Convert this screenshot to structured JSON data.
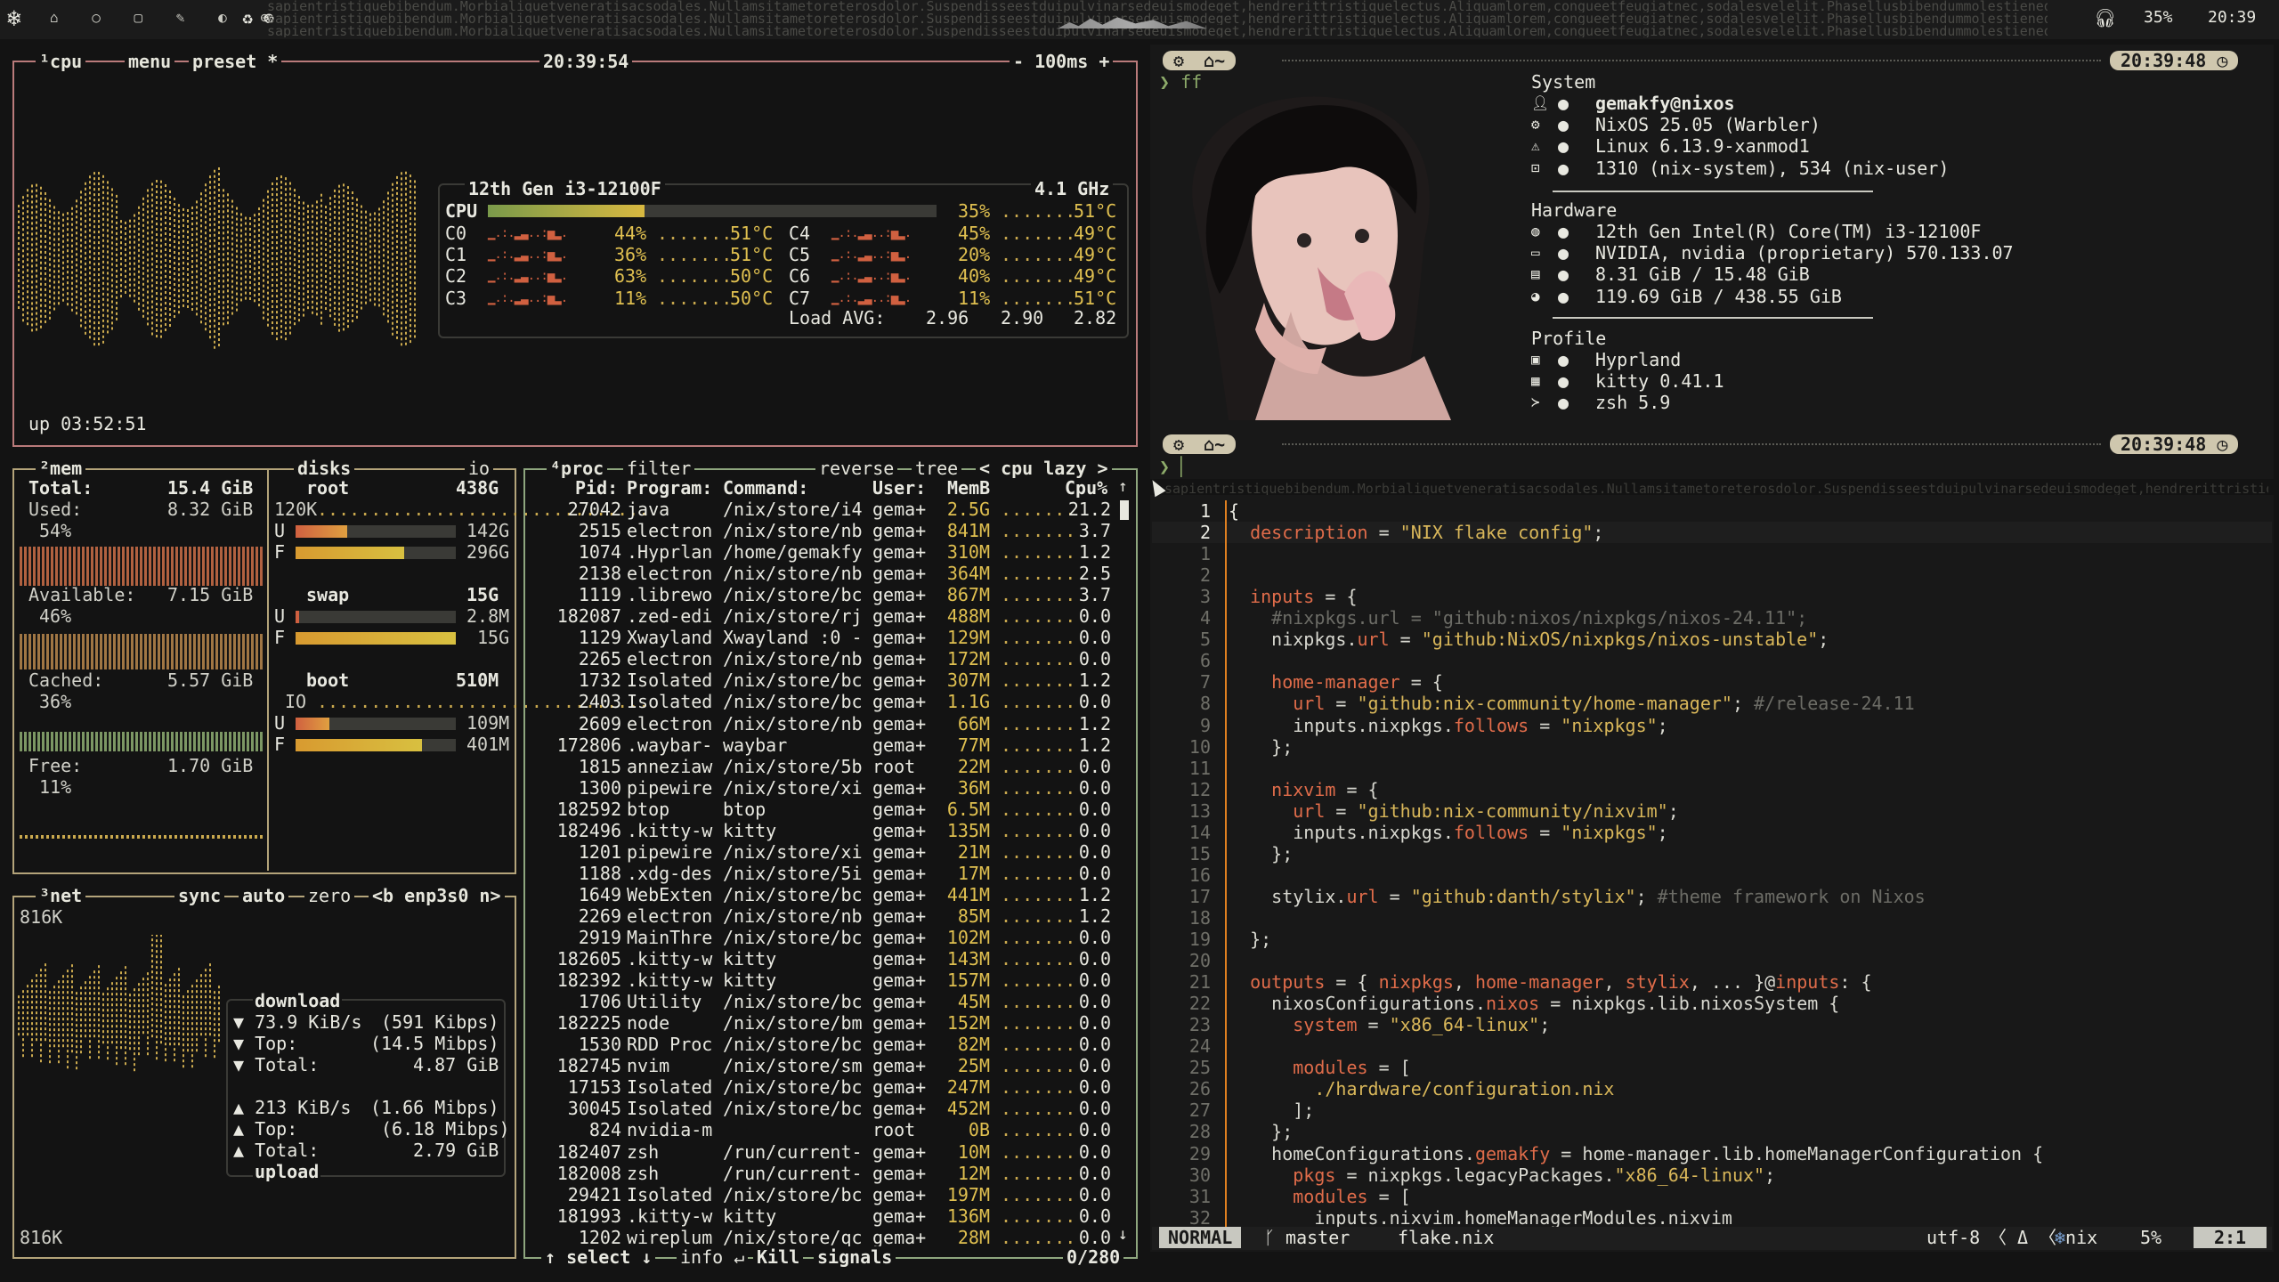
{
  "topbar": {
    "percent": "35%",
    "clock": "20:39",
    "noise": "sapientristiquebibendum.Morbialiquetveneratisacsodales.Nullamsitametoreterosdolor.Suspendisseestduipulvinarsedeuismodeget,hendrerittristiquelectus.Aliquamlorem,congueetfeugiatnec,sodalesvelelit.Phasellusbibendummolestieneque,velsuscipitmolestieque.Inhacha"
  },
  "cpu": {
    "title": "cpu",
    "menu": "menu",
    "preset": "preset *",
    "time": "20:39:54",
    "rate": "- 100ms +",
    "uptime": "up 03:52:51",
    "model": "12th Gen i3-12100F",
    "freq": "4.1 GHz",
    "total_label": "CPU",
    "total_pct": "35%",
    "total_temp": "51°C",
    "total_fill": 0.35,
    "cores": [
      {
        "name": "C0",
        "pct": "44%",
        "temp": "51°C"
      },
      {
        "name": "C1",
        "pct": "36%",
        "temp": "51°C"
      },
      {
        "name": "C2",
        "pct": "63%",
        "temp": "50°C"
      },
      {
        "name": "C3",
        "pct": "11%",
        "temp": "50°C"
      },
      {
        "name": "C4",
        "pct": "45%",
        "temp": "49°C"
      },
      {
        "name": "C5",
        "pct": "20%",
        "temp": "49°C"
      },
      {
        "name": "C6",
        "pct": "40%",
        "temp": "49°C"
      },
      {
        "name": "C7",
        "pct": "11%",
        "temp": "51°C"
      }
    ],
    "load_label": "Load AVG:",
    "load": [
      "2.96",
      "2.90",
      "2.82"
    ]
  },
  "mem": {
    "title": "mem",
    "total_label": "Total:",
    "total": "15.4 GiB",
    "used_label": "Used:",
    "used": "8.32 GiB",
    "used_pct": "54%",
    "avail_label": "Available:",
    "avail": "7.15 GiB",
    "avail_pct": "46%",
    "cached_label": "Cached:",
    "cached": "5.57 GiB",
    "cached_pct": "36%",
    "free_label": "Free:",
    "free": "1.70 GiB",
    "free_pct": "11%"
  },
  "disks": {
    "title": "disks",
    "io": "io",
    "root": {
      "name": "root",
      "size": "438G",
      "io": "120K",
      "u": "142G",
      "f": "296G",
      "u_fill": 0.32,
      "f_fill": 0.68
    },
    "swap": {
      "name": "swap",
      "size": "15G",
      "u": "2.8M",
      "f": "15G",
      "u_fill": 0.02,
      "f_fill": 1.0
    },
    "boot": {
      "name": "boot",
      "size": "510M",
      "io": "IO",
      "u": "109M",
      "f": "401M",
      "u_fill": 0.21,
      "f_fill": 0.79
    }
  },
  "net": {
    "title": "net",
    "sync": "sync",
    "auto": "auto",
    "zero": "zero",
    "iface": "<b enp3s0 n>",
    "scale_top": "816K",
    "scale_bottom": "816K",
    "download": "download",
    "dl_rate": "73.9 KiB/s",
    "dl_rate_b": "(591 Kibps)",
    "dl_top": "(14.5 Mibps)",
    "dl_total": "4.87 GiB",
    "ul_rate": "213 KiB/s",
    "ul_rate_b": "(1.66 Mibps)",
    "ul_top": "(6.18 Mibps)",
    "ul_total": "2.79 GiB",
    "upload": "upload",
    "top_label": "Top:",
    "total_label": "Total:"
  },
  "proc": {
    "title": "proc",
    "filter": "filter",
    "reverse": "reverse",
    "tree": "tree",
    "sort": "< cpu lazy >",
    "headers": {
      "pid": "Pid:",
      "program": "Program:",
      "command": "Command:",
      "user": "User:",
      "mem": "MemB",
      "cpu": "Cpu%"
    },
    "rows": [
      [
        "27042",
        "java",
        "/nix/store/i4",
        "gema+",
        "2.5G",
        "21.2"
      ],
      [
        "2515",
        "electron",
        "/nix/store/nb",
        "gema+",
        "841M",
        "3.7"
      ],
      [
        "1074",
        ".Hyprlan",
        "/home/gemakfy",
        "gema+",
        "310M",
        "1.2"
      ],
      [
        "2138",
        "electron",
        "/nix/store/nb",
        "gema+",
        "364M",
        "2.5"
      ],
      [
        "1119",
        ".librewo",
        "/nix/store/bc",
        "gema+",
        "867M",
        "3.7"
      ],
      [
        "182087",
        ".zed-edi",
        "/nix/store/rj",
        "gema+",
        "488M",
        "0.0"
      ],
      [
        "1129",
        "Xwayland",
        "Xwayland :0 -",
        "gema+",
        "129M",
        "0.0"
      ],
      [
        "2265",
        "electron",
        "/nix/store/nb",
        "gema+",
        "172M",
        "0.0"
      ],
      [
        "1732",
        "Isolated",
        "/nix/store/bc",
        "gema+",
        "307M",
        "1.2"
      ],
      [
        "2403",
        "Isolated",
        "/nix/store/bc",
        "gema+",
        "1.1G",
        "0.0"
      ],
      [
        "2609",
        "electron",
        "/nix/store/nb",
        "gema+",
        "66M",
        "1.2"
      ],
      [
        "172806",
        ".waybar-",
        "waybar",
        "gema+",
        "77M",
        "1.2"
      ],
      [
        "1815",
        "anneziaw",
        "/nix/store/5b",
        "root",
        "22M",
        "0.0"
      ],
      [
        "1300",
        "pipewire",
        "/nix/store/xi",
        "gema+",
        "36M",
        "0.0"
      ],
      [
        "182592",
        "btop",
        "btop",
        "gema+",
        "6.5M",
        "0.0"
      ],
      [
        "182496",
        ".kitty-w",
        "kitty",
        "gema+",
        "135M",
        "0.0"
      ],
      [
        "1201",
        "pipewire",
        "/nix/store/xi",
        "gema+",
        "21M",
        "0.0"
      ],
      [
        "1188",
        ".xdg-des",
        "/nix/store/5i",
        "gema+",
        "17M",
        "0.0"
      ],
      [
        "1649",
        "WebExten",
        "/nix/store/bc",
        "gema+",
        "441M",
        "1.2"
      ],
      [
        "2269",
        "electron",
        "/nix/store/nb",
        "gema+",
        "85M",
        "1.2"
      ],
      [
        "2919",
        "MainThre",
        "/nix/store/bc",
        "gema+",
        "102M",
        "0.0"
      ],
      [
        "182605",
        ".kitty-w",
        "kitty",
        "gema+",
        "143M",
        "0.0"
      ],
      [
        "182392",
        ".kitty-w",
        "kitty",
        "gema+",
        "157M",
        "0.0"
      ],
      [
        "1706",
        "Utility",
        "/nix/store/bc",
        "gema+",
        "45M",
        "0.0"
      ],
      [
        "182225",
        "node",
        "/nix/store/bm",
        "gema+",
        "152M",
        "0.0"
      ],
      [
        "1530",
        "RDD Proc",
        "/nix/store/bc",
        "gema+",
        "82M",
        "0.0"
      ],
      [
        "182745",
        "nvim",
        "/nix/store/sm",
        "gema+",
        "25M",
        "0.0"
      ],
      [
        "17153",
        "Isolated",
        "/nix/store/bc",
        "gema+",
        "247M",
        "0.0"
      ],
      [
        "30045",
        "Isolated",
        "/nix/store/bc",
        "gema+",
        "452M",
        "0.0"
      ],
      [
        "824",
        "nvidia-m",
        "",
        "root",
        "0B",
        "0.0"
      ],
      [
        "182407",
        "zsh",
        "/run/current-",
        "gema+",
        "10M",
        "0.0"
      ],
      [
        "182008",
        "zsh",
        "/run/current-",
        "gema+",
        "12M",
        "0.0"
      ],
      [
        "29421",
        "Isolated",
        "/nix/store/bc",
        "gema+",
        "197M",
        "0.0"
      ],
      [
        "181993",
        ".kitty-w",
        "kitty",
        "gema+",
        "136M",
        "0.0"
      ],
      [
        "1202",
        "wireplum",
        "/nix/store/qc",
        "gema+",
        "28M",
        "0.0"
      ]
    ],
    "footer_select": "↑ select ↓",
    "footer_info": "info ↵",
    "footer_kill": "Kill",
    "footer_signals": "signals",
    "count": "0/280"
  },
  "ff": {
    "time": "20:39:48",
    "prompt_cmd": "ff",
    "home": "~",
    "system_header": "System",
    "hardware_header": "Hardware",
    "profile_header": "Profile",
    "lines_system": [
      "gemakfy@nixos",
      "NixOS 25.05 (Warbler)",
      "Linux 6.13.9-xanmod1",
      "1310 (nix-system), 534 (nix-user)"
    ],
    "lines_hardware": [
      "12th Gen Intel(R) Core(TM) i3-12100F",
      "NVIDIA, nvidia (proprietary) 570.133.07",
      "8.31 GiB / 15.48 GiB",
      "119.69 GiB / 438.55 GiB"
    ],
    "lines_profile": [
      "Hyprland",
      "kitty 0.41.1",
      "zsh 5.9"
    ],
    "time2": "20:39:48"
  },
  "nvim": {
    "mode": "NORMAL",
    "branch": "master",
    "file": "flake.nix",
    "encoding": "utf-8",
    "ft": "nix",
    "percent": "5%",
    "pos": "2:1",
    "cur_nums": [
      "1",
      "2"
    ],
    "rel_nums": [
      "1",
      "2",
      "3",
      "4",
      "5",
      "6",
      "7",
      "8",
      "9",
      "10",
      "11",
      "12",
      "13",
      "14",
      "15",
      "16",
      "17",
      "18",
      "19",
      "20",
      "21",
      "22",
      "23",
      "24",
      "25",
      "26",
      "27",
      "28",
      "29",
      "30",
      "31",
      "32"
    ]
  }
}
